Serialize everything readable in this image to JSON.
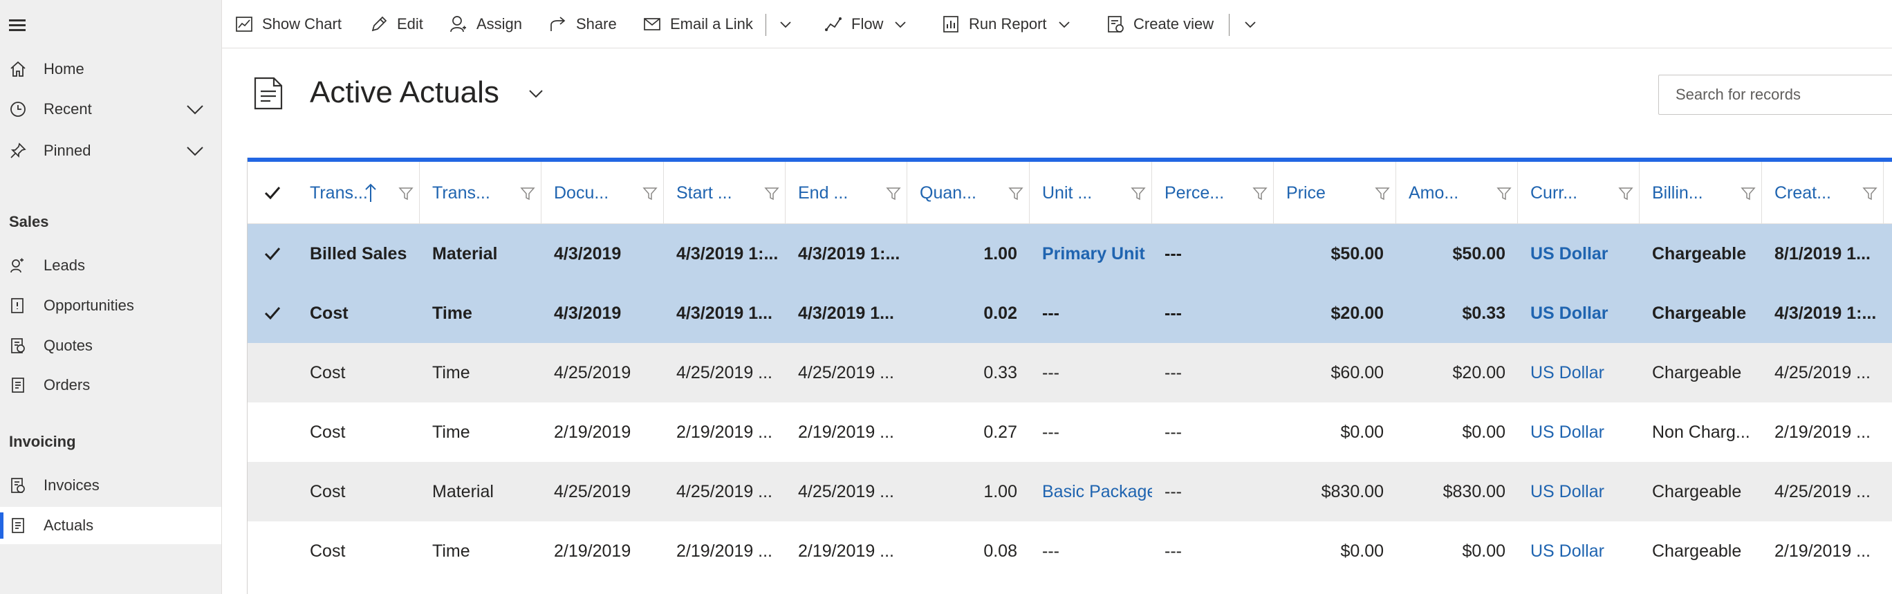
{
  "sidebar": {
    "items": [
      {
        "label": "Home"
      },
      {
        "label": "Recent"
      },
      {
        "label": "Pinned"
      }
    ],
    "groups": [
      {
        "title": "Sales",
        "items": [
          {
            "label": "Leads"
          },
          {
            "label": "Opportunities"
          },
          {
            "label": "Quotes"
          },
          {
            "label": "Orders"
          }
        ]
      },
      {
        "title": "Invoicing",
        "items": [
          {
            "label": "Invoices"
          },
          {
            "label": "Actuals"
          }
        ]
      }
    ],
    "active_item": "Actuals"
  },
  "commandbar": {
    "show_chart": "Show Chart",
    "edit": "Edit",
    "assign": "Assign",
    "share": "Share",
    "email_link": "Email a Link",
    "flow": "Flow",
    "run_report": "Run Report",
    "create_view": "Create view"
  },
  "view": {
    "title": "Active Actuals"
  },
  "search": {
    "placeholder": "Search for records"
  },
  "grid": {
    "columns": [
      "Trans...",
      "Trans...",
      "Docu...",
      "Start ...",
      "End ...",
      "Quan...",
      "Unit ...",
      "Perce...",
      "Price",
      "Amo...",
      "Curr...",
      "Billin...",
      "Creat..."
    ],
    "sorted_column_index": 0,
    "sort_direction": "ascending",
    "rows": [
      {
        "selected": true,
        "cells": [
          "Billed Sales",
          "Material",
          "4/3/2019",
          "4/3/2019 1:...",
          "4/3/2019 1:...",
          "1.00",
          "Primary Unit",
          "---",
          "$50.00",
          "$50.00",
          "US Dollar",
          "Chargeable",
          "8/1/2019 1..."
        ]
      },
      {
        "selected": true,
        "cells": [
          "Cost",
          "Time",
          "4/3/2019",
          "4/3/2019 1...",
          "4/3/2019 1...",
          "0.02",
          "---",
          "---",
          "$20.00",
          "$0.33",
          "US Dollar",
          "Chargeable",
          "4/3/2019 1:..."
        ]
      },
      {
        "selected": false,
        "cells": [
          "Cost",
          "Time",
          "4/25/2019",
          "4/25/2019 ...",
          "4/25/2019 ...",
          "0.33",
          "---",
          "---",
          "$60.00",
          "$20.00",
          "US Dollar",
          "Chargeable",
          "4/25/2019 ..."
        ]
      },
      {
        "selected": false,
        "cells": [
          "Cost",
          "Time",
          "2/19/2019",
          "2/19/2019 ...",
          "2/19/2019 ...",
          "0.27",
          "---",
          "---",
          "$0.00",
          "$0.00",
          "US Dollar",
          "Non Charg...",
          "2/19/2019 ..."
        ]
      },
      {
        "selected": false,
        "cells": [
          "Cost",
          "Material",
          "4/25/2019",
          "4/25/2019 ...",
          "4/25/2019 ...",
          "1.00",
          "Basic Package",
          "---",
          "$830.00",
          "$830.00",
          "US Dollar",
          "Chargeable",
          "4/25/2019 ..."
        ]
      },
      {
        "selected": false,
        "cells": [
          "Cost",
          "Time",
          "2/19/2019",
          "2/19/2019 ...",
          "2/19/2019 ...",
          "0.08",
          "---",
          "---",
          "$0.00",
          "$0.00",
          "US Dollar",
          "Chargeable",
          "2/19/2019 ..."
        ]
      }
    ]
  },
  "colors": {
    "accent": "#2266e3",
    "link": "#1f64b0",
    "selected_row": "#bfd4ea",
    "alt_row": "#ededed",
    "sidebar_bg": "#efefef"
  }
}
